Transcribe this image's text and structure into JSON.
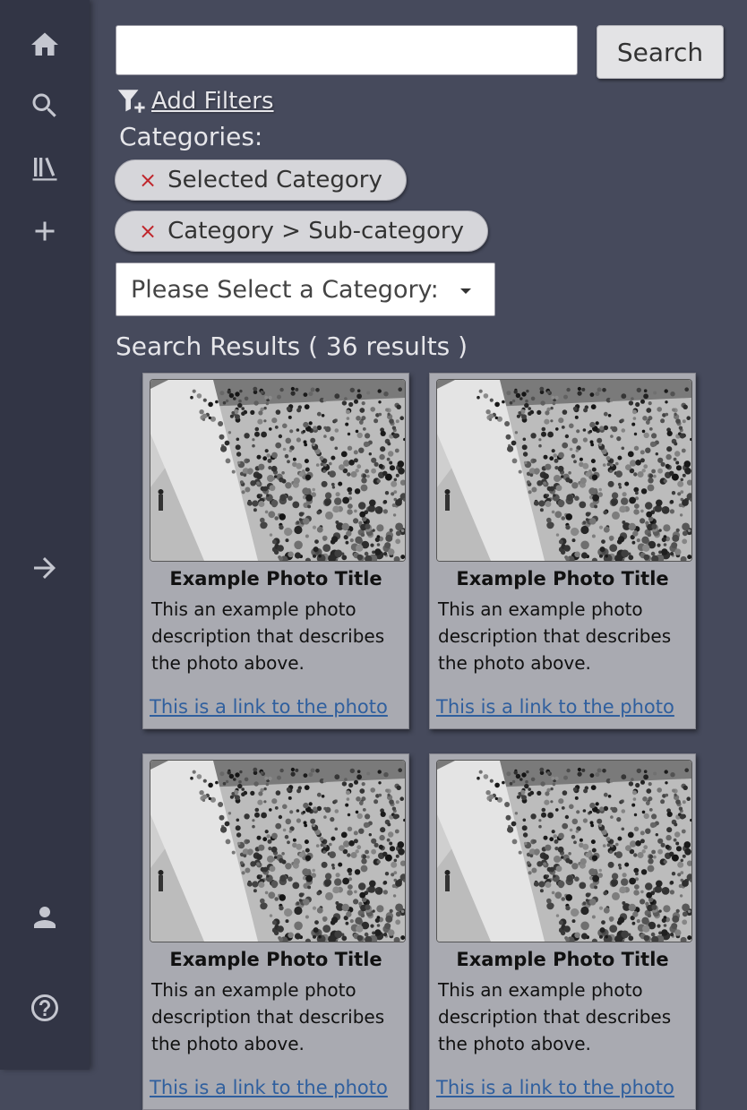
{
  "sidebar": {
    "icons": [
      "home-icon",
      "search-icon",
      "library-icon",
      "add-icon",
      "arrow-right-icon",
      "user-icon",
      "help-icon"
    ]
  },
  "search": {
    "value": "",
    "placeholder": "",
    "button_label": "Search"
  },
  "filters": {
    "label": "Add Filters"
  },
  "categories": {
    "label": "Categories:",
    "selected": [
      "Selected Category",
      "Category > Sub-category"
    ],
    "remove_glyph": "×",
    "dropdown_value": "Please Select a Category:"
  },
  "results": {
    "title": "Search Results ( 36 results )",
    "cards": [
      {
        "title": "Example Photo Title",
        "description": "This an example photo description that describes the photo above.",
        "link": "This is a link to the photo"
      },
      {
        "title": "Example Photo Title",
        "description": "This an example photo description that describes the photo above.",
        "link": "This is a link to the photo"
      },
      {
        "title": "Example Photo Title",
        "description": "This an example photo description that describes the photo above.",
        "link": "This is a link to the photo"
      },
      {
        "title": "Example Photo Title",
        "description": "This an example photo description that describes the photo above.",
        "link": "This is a link to the photo"
      }
    ]
  },
  "colors": {
    "background": "#464a5c",
    "sidebar": "#323545",
    "card": "#a9aab1",
    "link": "#2f5f9e",
    "chip_remove": "#c0262c"
  }
}
